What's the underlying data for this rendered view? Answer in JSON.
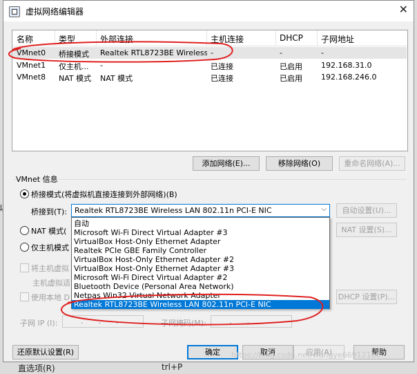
{
  "window": {
    "title": "虚拟网络编辑器",
    "close_glyph": "✕"
  },
  "table": {
    "columns": [
      "名称",
      "类型",
      "外部连接",
      "主机连接",
      "DHCP",
      "子网地址"
    ],
    "rows": [
      [
        "VMnet0",
        "桥接模式",
        "Realtek RTL8723BE Wireless...",
        "-",
        "-",
        "-"
      ],
      [
        "VMnet1",
        "仅主机...",
        "-",
        "已连接",
        "已启用",
        "192.168.31.0"
      ],
      [
        "VMnet8",
        "NAT 模式",
        "NAT 模式",
        "已连接",
        "已启用",
        "192.168.246.0"
      ]
    ]
  },
  "list_buttons": {
    "add": "添加网络(E)...",
    "remove": "移除网络(O)",
    "rename": "重命名网络(A)..."
  },
  "vmnet_info": {
    "title": "VMnet 信息",
    "bridged_label": "桥接模式(将虚拟机直接连接到外部网络)(B)",
    "bridge_to_label": "桥接到(T):",
    "bridge_to_value": "Realtek RTL8723BE Wireless LAN 802.11n PCI-E NIC",
    "auto_settings": "自动设置(U)...",
    "nat_label": "NAT 模式(",
    "nat_settings": "NAT 设置(S)...",
    "hostonly_label": "仅主机模式",
    "connect_host_label": "将主机虚拟",
    "host_adapter_label": "主机虚拟适",
    "use_dhcp_label": "使用本地 D",
    "dhcp_settings": "DHCP 设置(P)...",
    "subnet_ip_label": "子网 IP (I):",
    "subnet_mask_label": "子网掩码(M):",
    "ip_placeholder": "...",
    "mask_placeholder": "..."
  },
  "dropdown_options": [
    "自动",
    "Microsoft Wi-Fi Direct Virtual Adapter #3",
    "VirtualBox Host-Only Ethernet Adapter",
    "Realtek PCIe GBE Family Controller",
    "VirtualBox Host-Only Ethernet Adapter #2",
    "VirtualBox Host-Only Ethernet Adapter #3",
    "Microsoft Wi-Fi Direct Virtual Adapter #2",
    "Bluetooth Device (Personal Area Network)",
    "Netpas Win32 Virtual Network Adapter",
    "Realtek RTL8723BE Wireless LAN 802.11n PCI-E NIC"
  ],
  "footer": {
    "restore": "还原默认设置(R)",
    "ok": "确定",
    "cancel": "取消",
    "apply": "应用(A)",
    "help": "帮助"
  },
  "background": {
    "left_edge": "以",
    "bottom_left": "直选项(R)",
    "bottom_mid": "trl+P"
  },
  "watermark": "https://blog.csdn.net/wangye66912168",
  "colors": {
    "accent": "#0078d7",
    "annotation": "#e02020"
  }
}
